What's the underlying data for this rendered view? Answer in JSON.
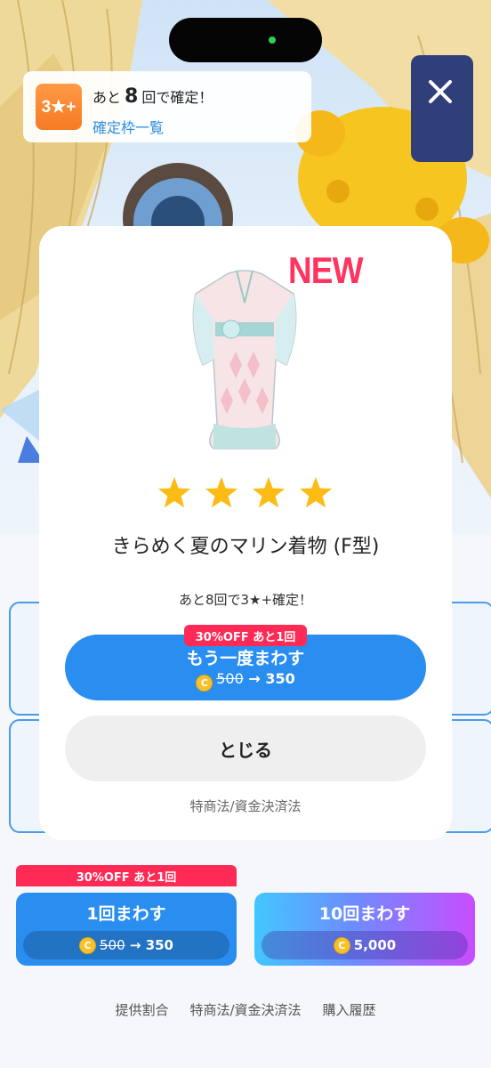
{
  "pity_banner": {
    "badge": "3★+",
    "prefix": "あと",
    "count": "8",
    "suffix": "回で確定！",
    "link": "確定枠一覧"
  },
  "modal": {
    "new_label": "NEW",
    "star_count": 4,
    "item_name": "きらめく夏のマリン着物 (F型)",
    "pity_text": "あと8回で3★+確定！",
    "discount_tag": "30%OFF あと1回",
    "again_label": "もう一度まわす",
    "again_old_price": "500",
    "again_arrow": "→",
    "again_new_price": "350",
    "close_label": "とじる",
    "legal_link": "特商法/資金決済法"
  },
  "bottom": {
    "discount_tag": "30%OFF あと1回",
    "single": {
      "label": "1回まわす",
      "old_price": "500",
      "arrow": "→",
      "new_price": "350"
    },
    "ten": {
      "label": "10回まわす",
      "price": "5,000"
    },
    "coin_symbol": "C"
  },
  "footer": {
    "links": [
      "提供割合",
      "特商法/資金決済法",
      "購入履歴"
    ]
  },
  "colors": {
    "accent_blue": "#2a8df0",
    "sale_red": "#ff2a55",
    "new_pink": "#ff3560",
    "star_gold": "#fdbb16"
  }
}
